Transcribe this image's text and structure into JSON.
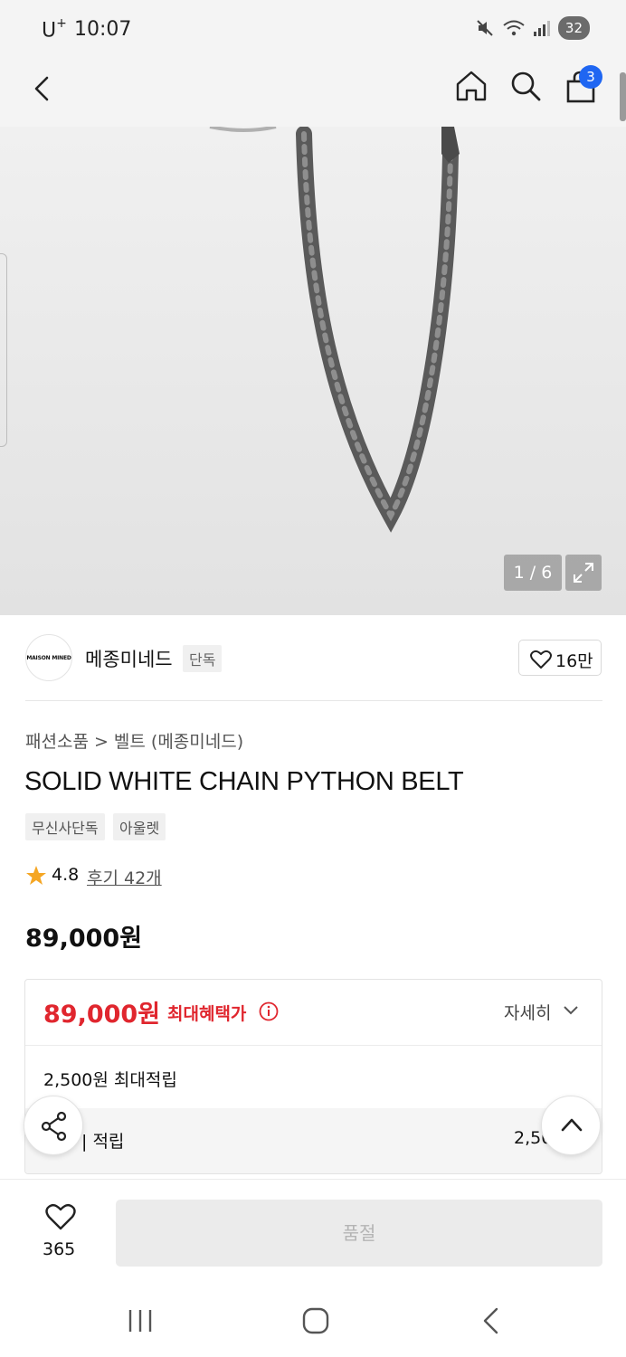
{
  "status_bar": {
    "carrier": "U",
    "carrier_sup": "+",
    "time": "10:07",
    "battery": "32"
  },
  "header": {
    "cart_badge": "3"
  },
  "gallery": {
    "counter": "1 / 6"
  },
  "brand": {
    "logo_text": "MAISON MINED",
    "name": "메종미네드",
    "exclusive_tag": "단독",
    "likes": "16만"
  },
  "product": {
    "breadcrumb": "패션소품 > 벨트 (메종미네드)",
    "title": "SOLID WHITE CHAIN PYTHON BELT",
    "tags": [
      "무신사단독",
      "아울렛"
    ],
    "rating": "4.8",
    "review_link": "후기 42개",
    "price": "89,000원"
  },
  "benefit": {
    "price": "89,000원",
    "label": "최대혜택가",
    "detail_toggle": "자세히",
    "points_max": "2,500원 최대적립",
    "points_row_label": "| 적립",
    "points_row_value": "2,50"
  },
  "bottom_bar": {
    "wish_count": "365",
    "soldout_label": "품절"
  },
  "colors": {
    "accent_red": "#e0262e",
    "badge_blue": "#1f66f2",
    "star": "#f5a623"
  }
}
